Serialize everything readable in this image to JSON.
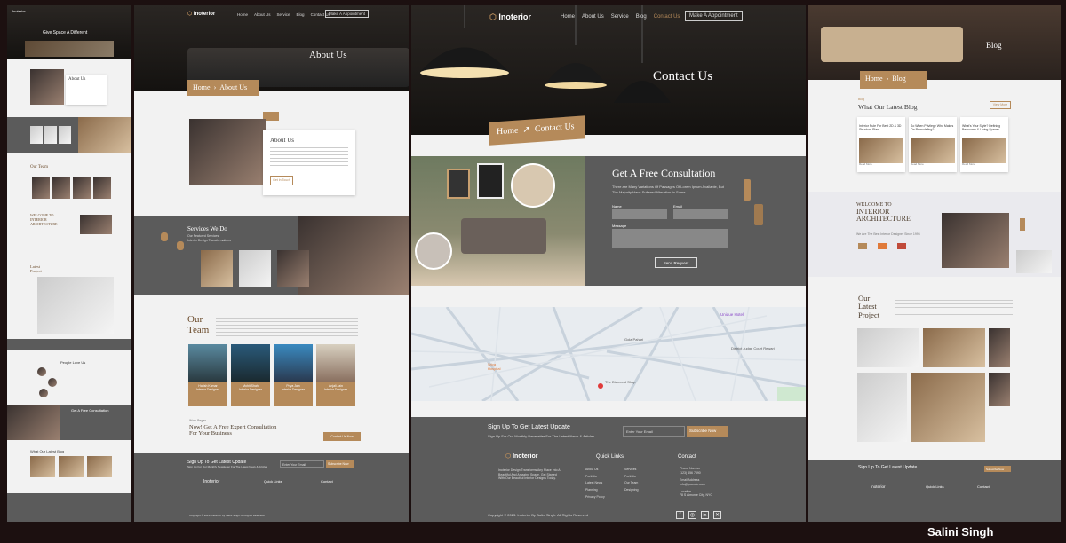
{
  "brand": "Inoterior",
  "author": "Salini Singh",
  "colors": {
    "accent": "#b58a5a",
    "dark": "#5b5b5b",
    "bg": "#f2f2f2"
  },
  "nav": [
    "Home",
    "About Us",
    "Service",
    "Blog",
    "Contact Us"
  ],
  "nav_cta": "Make A Appointment",
  "p1": {
    "hero": "Give Space A Different",
    "about": "About Us",
    "team": "Our Team",
    "interior_l1": "WELCOME TO",
    "interior_l2": "INTERIOR",
    "interior_l3": "ARCHITECTURE",
    "latest": "Latest Project",
    "people": "People Love Us",
    "consult": "Get A Free Consultation",
    "blog": "What Our Latest Blog"
  },
  "p2": {
    "hero_title": "About Us",
    "crumb_home": "Home",
    "crumb_page": "About Us",
    "about_title": "About Us",
    "about_btn": "Get In Touch",
    "services_title": "Services We Do",
    "services_sub1": "Our Featured Services",
    "services_sub2": "Interior Design Transformations",
    "team_l1": "Our",
    "team_l2": "Team",
    "members": [
      {
        "name": "Harish Kumar",
        "role": "Interior Designer"
      },
      {
        "name": "Mohit Shah",
        "role": "Interior Designer"
      },
      {
        "name": "Priya Jain",
        "role": "Interior Designer"
      },
      {
        "name": "Anjali Jain",
        "role": "Interior Designer"
      }
    ],
    "cta_small": "Work Began",
    "cta_l1": "Now! Get A Free Expert Consultation",
    "cta_l2": "For Your Business",
    "cta_btn": "Contact Us Now",
    "signup": "Sign Up To Get Latest Update",
    "signup_sub": "Sign Up For Our Monthly Newsletter For The Latest News & Articles",
    "email_ph": "Enter Your Email",
    "subscribe": "Subscribe Now",
    "quick": "Quick Links",
    "contact": "Contact",
    "copy": "Copyright © 2023. Inoterior by Salini Singh. All Rights Reserved"
  },
  "p3": {
    "hero": "Contact Us",
    "crumb_home": "Home",
    "crumb_page": "Contact Us",
    "consult": "Get A Free Consultation",
    "consult_l1": "There are Many Variations Of Passages Of Lorem Ipsum Available, But",
    "consult_l2": "The Majority Have Suffered Alteration In Some",
    "name": "Name",
    "email": "Email",
    "message": "Message",
    "send": "Send Request",
    "map_labels": [
      "Unique Hotel",
      "District Judge Court Rewari",
      "The Diamond Shop",
      "Sriva Hospital",
      "Gola Pahari"
    ],
    "signup": "Sign Up To Get Latest Update",
    "signup_sub": "Sign Up For Our Monthly Newsletter For The Latest News & Articles",
    "email_ph": "Enter Your Email",
    "subscribe": "Subscribe Now",
    "quick": "Quick Links",
    "contact": "Contact",
    "links1": [
      "About Us",
      "Portfolio",
      "Latest News",
      "Planning",
      "Privacy Policy"
    ],
    "links2": [
      "Services",
      "Portfolio",
      "Our Team",
      "Designing"
    ],
    "phone_label": "Phone Number",
    "phone": "(123) 456 7890",
    "email_label": "Email Address",
    "email_val": "info@yoursite.com",
    "loc_label": "Location",
    "loc_val": "78 S Almonte City, NYC",
    "desc": "Inoterior Design Transforms Any Place Into A Beautiful And Amazing Space. Get Started With Our Beautiful Interior Designs Today.",
    "copy": "Copyright © 2023. Inoterior By Salini Singh. All Rights Reserved"
  },
  "p4": {
    "hero": "Blog",
    "crumb_home": "Home",
    "crumb_page": "Blog",
    "blog_small": "Blog",
    "blog_title": "What Our Latest Blog",
    "view_more": "View More",
    "posts": [
      "Interior Rule For Best 2D & 3D Structure Plan",
      "So When Privilege Who Makes On Remodeling?",
      "What's Your Style? Defining Bedrooms & Living Spaces"
    ],
    "read": "Read More",
    "wel1": "WELCOME TO",
    "wel2": "INTERIOR",
    "wel3": "ARCHITECTURE",
    "wel_sub": "We Are The Best Interior Designer Since 1996",
    "latest1": "Our",
    "latest2": "Latest",
    "latest3": "Project",
    "signup": "Sign Up To Get Latest Update",
    "subscribe": "Subscribe Now",
    "quick": "Quick Links",
    "contact": "Contact"
  }
}
